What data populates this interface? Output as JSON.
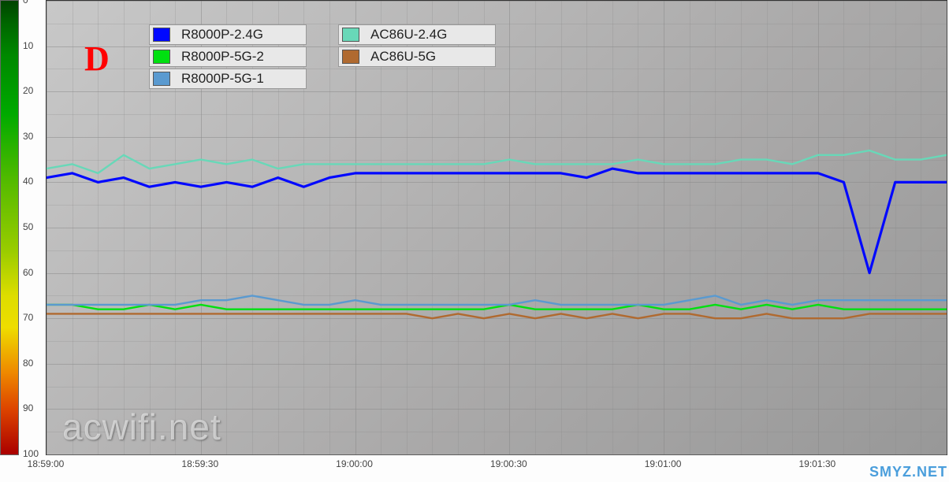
{
  "annotation": "D",
  "watermark1": "acwifi.net",
  "watermark2": "SMYZ.NET",
  "y_ticks": [
    "0",
    "10",
    "20",
    "30",
    "40",
    "50",
    "60",
    "70",
    "80",
    "90",
    "100"
  ],
  "x_ticks": [
    "18:59:00",
    "18:59:30",
    "19:00:00",
    "19:00:30",
    "19:01:00",
    "19:01:30"
  ],
  "legend": {
    "col1": [
      {
        "label": "R8000P-2.4G",
        "color": "#0008ff"
      },
      {
        "label": "R8000P-5G-2",
        "color": "#00e010"
      },
      {
        "label": "R8000P-5G-1",
        "color": "#5a9ad0"
      }
    ],
    "col2": [
      {
        "label": "AC86U-2.4G",
        "color": "#68d8b8"
      },
      {
        "label": "AC86U-5G",
        "color": "#b06a30"
      }
    ]
  },
  "chart_data": {
    "type": "line",
    "xlabel": "",
    "ylabel": "",
    "ylim": [
      0,
      100
    ],
    "y_inverted": true,
    "x": [
      "18:59:00",
      "18:59:05",
      "18:59:10",
      "18:59:15",
      "18:59:20",
      "18:59:25",
      "18:59:30",
      "18:59:35",
      "18:59:40",
      "18:59:45",
      "18:59:50",
      "18:59:55",
      "19:00:00",
      "19:00:05",
      "19:00:10",
      "19:00:15",
      "19:00:20",
      "19:00:25",
      "19:00:30",
      "19:00:35",
      "19:00:40",
      "19:00:45",
      "19:00:50",
      "19:00:55",
      "19:01:00",
      "19:01:05",
      "19:01:10",
      "19:01:15",
      "19:01:20",
      "19:01:25",
      "19:01:30",
      "19:01:35",
      "19:01:40",
      "19:01:45",
      "19:01:50",
      "19:01:55"
    ],
    "series": [
      {
        "name": "R8000P-2.4G",
        "color": "#0008ff",
        "values": [
          39,
          38,
          40,
          39,
          41,
          40,
          41,
          40,
          41,
          39,
          41,
          39,
          38,
          38,
          38,
          38,
          38,
          38,
          38,
          38,
          38,
          39,
          37,
          38,
          38,
          38,
          38,
          38,
          38,
          38,
          38,
          40,
          60,
          40,
          40,
          40
        ]
      },
      {
        "name": "R8000P-5G-2",
        "color": "#00e010",
        "values": [
          67,
          67,
          68,
          68,
          67,
          68,
          67,
          68,
          68,
          68,
          68,
          68,
          68,
          68,
          68,
          68,
          68,
          68,
          67,
          68,
          68,
          68,
          68,
          67,
          68,
          68,
          67,
          68,
          67,
          68,
          67,
          68,
          68,
          68,
          68,
          68
        ]
      },
      {
        "name": "R8000P-5G-1",
        "color": "#5a9ad0",
        "values": [
          67,
          67,
          67,
          67,
          67,
          67,
          66,
          66,
          65,
          66,
          67,
          67,
          66,
          67,
          67,
          67,
          67,
          67,
          67,
          66,
          67,
          67,
          67,
          67,
          67,
          66,
          65,
          67,
          66,
          67,
          66,
          66,
          66,
          66,
          66,
          66
        ]
      },
      {
        "name": "AC86U-2.4G",
        "color": "#68d8b8",
        "values": [
          37,
          36,
          38,
          34,
          37,
          36,
          35,
          36,
          35,
          37,
          36,
          36,
          36,
          36,
          36,
          36,
          36,
          36,
          35,
          36,
          36,
          36,
          36,
          35,
          36,
          36,
          36,
          35,
          35,
          36,
          34,
          34,
          33,
          35,
          35,
          34
        ]
      },
      {
        "name": "AC86U-5G",
        "color": "#b06a30",
        "values": [
          69,
          69,
          69,
          69,
          69,
          69,
          69,
          69,
          69,
          69,
          69,
          69,
          69,
          69,
          69,
          70,
          69,
          70,
          69,
          70,
          69,
          70,
          69,
          70,
          69,
          69,
          70,
          70,
          69,
          70,
          70,
          70,
          69,
          69,
          69,
          69
        ]
      }
    ]
  }
}
